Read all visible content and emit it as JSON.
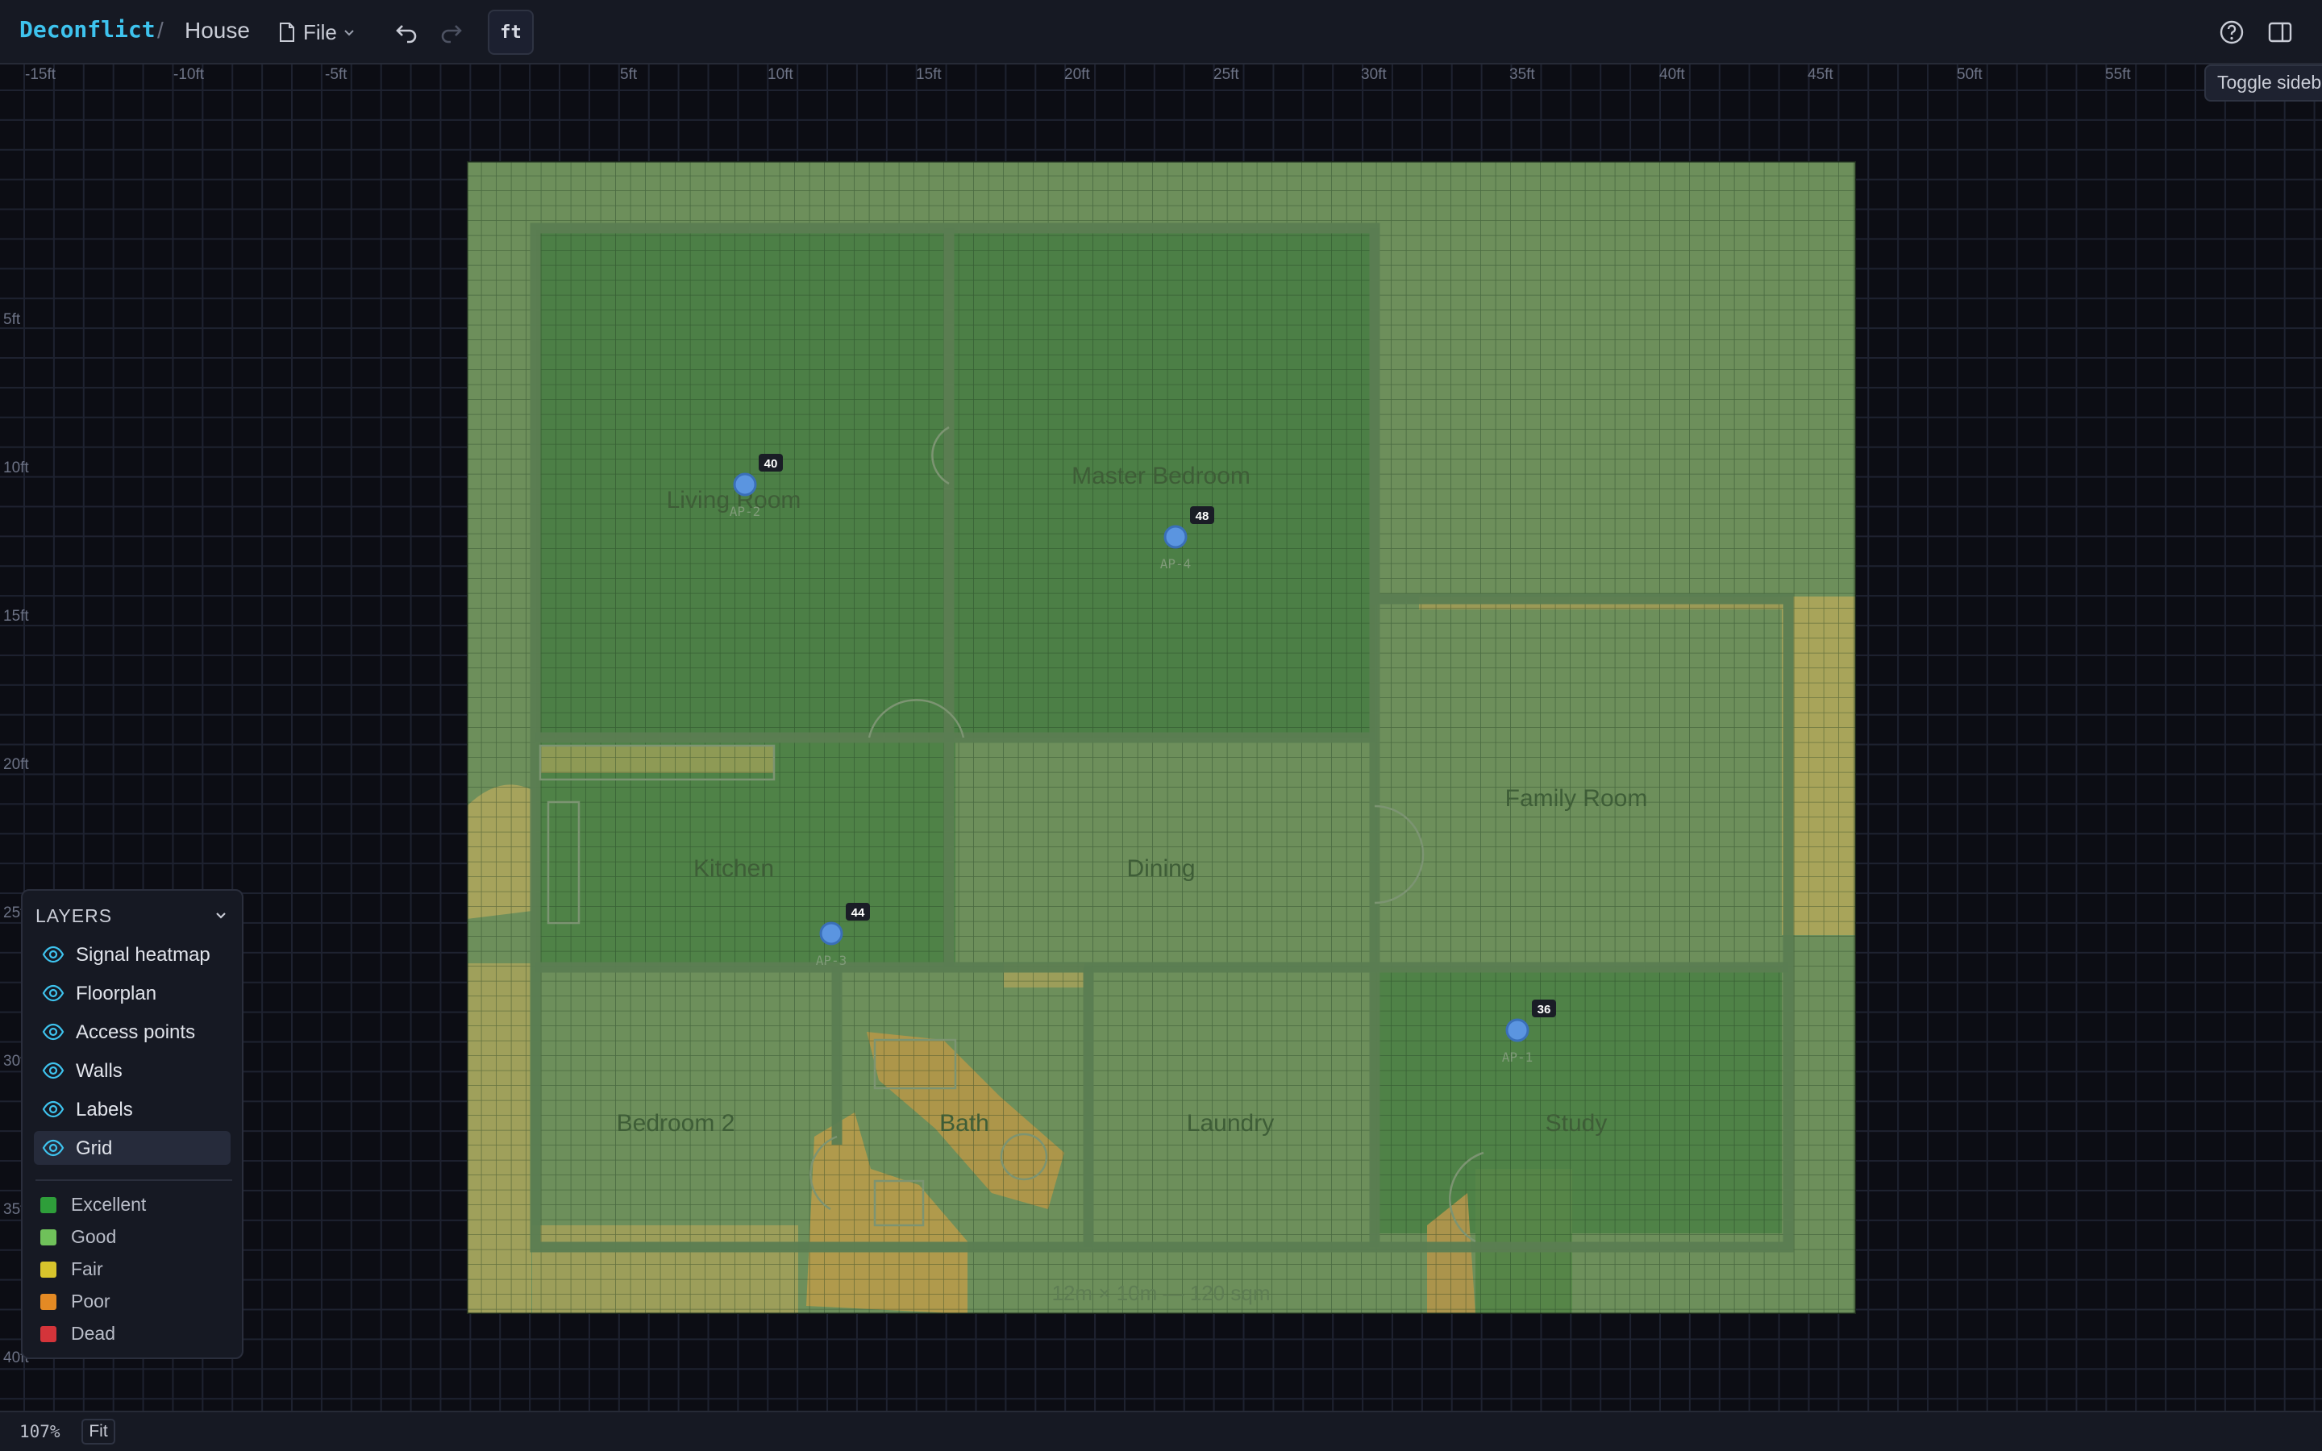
{
  "header": {
    "brand": "Deconflict",
    "separator": "/",
    "project": "House",
    "file_menu": "File",
    "unit_toggle": "ft",
    "tooltip": "Toggle sidebar"
  },
  "rulers": {
    "top": [
      "-15ft",
      "-10ft",
      "-5ft",
      "5ft",
      "10ft",
      "15ft",
      "20ft",
      "25ft",
      "30ft",
      "35ft",
      "40ft",
      "45ft",
      "50ft",
      "55ft"
    ],
    "left": [
      "5ft",
      "10ft",
      "15ft",
      "20ft",
      "25ft",
      "30ft",
      "35ft",
      "40ft"
    ]
  },
  "floorplan": {
    "rooms": [
      "Living Room",
      "Master Bedroom",
      "Kitchen",
      "Dining",
      "Family Room",
      "Bedroom 2",
      "Bath",
      "Laundry",
      "Study"
    ],
    "dimensions": "12m × 10m — 120 sqm",
    "access_points": [
      {
        "name": "AP-2",
        "badge": "40"
      },
      {
        "name": "AP-4",
        "badge": "48"
      },
      {
        "name": "AP-3",
        "badge": "44"
      },
      {
        "name": "AP-1",
        "badge": "36"
      }
    ]
  },
  "layers": {
    "title": "LAYERS",
    "items": [
      "Signal heatmap",
      "Floorplan",
      "Access points",
      "Walls",
      "Labels",
      "Grid"
    ],
    "active": "Grid"
  },
  "legend": [
    {
      "label": "Excellent",
      "color": "#2e9e3a"
    },
    {
      "label": "Good",
      "color": "#6fc15a"
    },
    {
      "label": "Fair",
      "color": "#d8c42c"
    },
    {
      "label": "Poor",
      "color": "#e48a24"
    },
    {
      "label": "Dead",
      "color": "#d4343a"
    }
  ],
  "status": {
    "zoom": "107%",
    "fit": "Fit"
  },
  "colors": {
    "accent": "#3ec3ee",
    "ap_marker": "#5b95e0"
  }
}
